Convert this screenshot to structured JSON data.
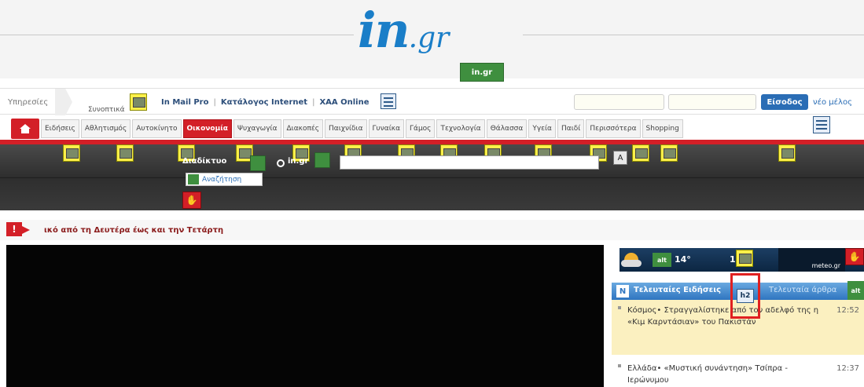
{
  "header": {
    "logo_main": "in",
    "logo_suffix": ".gr",
    "logo_alt_badge": "in.gr"
  },
  "services": {
    "label": "Υπηρεσίες",
    "sub_label": "Συνοπτικά",
    "links": [
      "In Mail Pro",
      "Κατάλογος Internet",
      "ΧΑΑ Online"
    ],
    "login_button": "Είσοδος",
    "member_link": "νέο μέλος"
  },
  "nav": {
    "tabs": [
      {
        "label": "Ειδήσεις",
        "active": false
      },
      {
        "label": "Αθλητισμός",
        "active": false
      },
      {
        "label": "Αυτοκίνητο",
        "active": false
      },
      {
        "label": "Οικονομία",
        "active": true
      },
      {
        "label": "Ψυχαγωγία",
        "active": false
      },
      {
        "label": "Διακοπές",
        "active": false
      },
      {
        "label": "Παιχνίδια",
        "active": false
      },
      {
        "label": "Γυναίκα",
        "active": false
      },
      {
        "label": "Γάμος",
        "active": false
      },
      {
        "label": "Τεχνολογία",
        "active": false
      },
      {
        "label": "Θάλασσα",
        "active": false
      },
      {
        "label": "Υγεία",
        "active": false
      },
      {
        "label": "Παιδί",
        "active": false
      },
      {
        "label": "Περισσότερα",
        "active": false
      },
      {
        "label": "Shopping",
        "active": false
      }
    ]
  },
  "search": {
    "option_web": "Διαδίκτυο",
    "option_site": "in.gr",
    "button_label": "Αναζήτηση",
    "key_letter": "A"
  },
  "breaking": {
    "text": "ικό από τη Δευτέρα έως και την Τετάρτη"
  },
  "weather": {
    "temp_1": "14°",
    "temp_2": "14°",
    "provider": "meteo.gr"
  },
  "news": {
    "tab_latest": "Τελευταίες Ειδήσεις",
    "tab_latest_articles": "Τελευταία άρθρα",
    "h2_badge": "h2",
    "items": [
      {
        "text": "Κόσμος• Στραγγαλίστηκε από τον αδελφό της η «Κιμ Καρντάσιαν» του Πακιστάν",
        "time": "12:52"
      },
      {
        "text": "Ελλάδα• «Μυστική συνάντηση» Τσίπρα - Ιερώνυμου",
        "time": "12:37"
      }
    ]
  },
  "colors": {
    "accent_red": "#d31f27",
    "link_blue": "#2a6db5",
    "placeholder_yellow": "#fff04a"
  }
}
